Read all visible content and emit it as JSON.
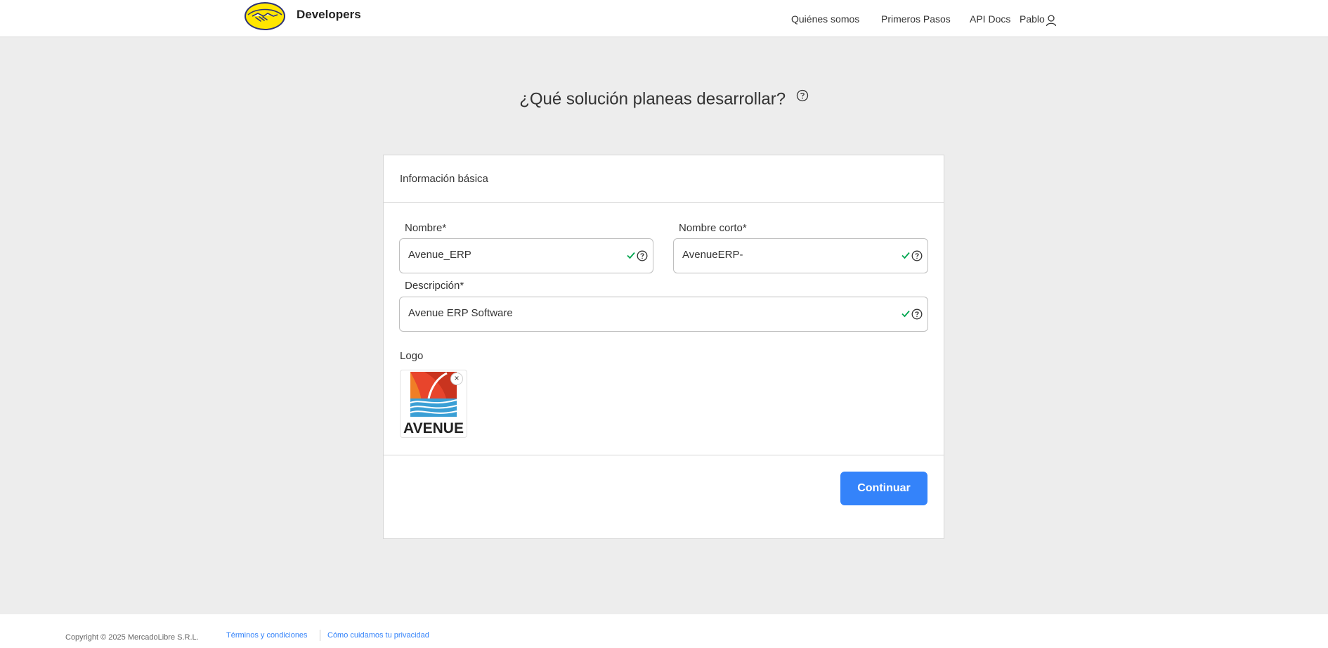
{
  "header": {
    "brand": "Developers",
    "nav": {
      "about": "Quiénes somos",
      "first_steps": "Primeros Pasos",
      "api_docs": "API Docs",
      "user": "Pablo"
    }
  },
  "page": {
    "title": "¿Qué solución planeas desarrollar?"
  },
  "card": {
    "header": "Información básica",
    "fields": {
      "name": {
        "label": "Nombre*",
        "value": "Avenue_ERP"
      },
      "short_name": {
        "label": "Nombre corto*",
        "value": "AvenueERP-"
      },
      "description": {
        "label": "Descripción*",
        "value": "Avenue ERP Software"
      }
    },
    "logo_label": "Logo",
    "logo_text": "AVENUE",
    "remove_glyph": "×",
    "continue": "Continuar"
  },
  "footer": {
    "copyright": "Copyright © 2025 MercadoLibre S.R.L.",
    "terms": "Términos y condiciones",
    "privacy": "Cómo cuidamos tu privacidad"
  },
  "colors": {
    "accent": "#3483fa",
    "valid": "#00a650",
    "brand_yellow": "#ffe600",
    "brand_navy": "#2d3277",
    "page_bg": "#ededed"
  },
  "icons": {
    "logo": "mercadolibre-handshake-logo",
    "user": "user-icon",
    "help": "help-circle-icon",
    "check": "check-icon",
    "close": "close-icon"
  }
}
